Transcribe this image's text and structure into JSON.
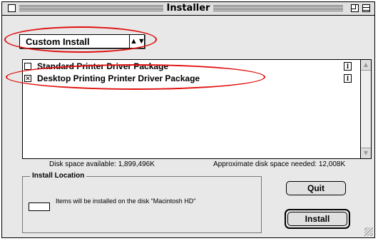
{
  "window": {
    "title": "Installer"
  },
  "install_type": {
    "selected": "Custom Install"
  },
  "packages": [
    {
      "label": "Standard Printer Driver Package",
      "checked": false,
      "check_mark": ""
    },
    {
      "label": "Desktop Printing Printer Driver Package",
      "checked": true,
      "check_mark": "✕"
    }
  ],
  "disk": {
    "available": "Disk space available: 1,899,496K",
    "needed": "Approximate disk space needed: 12,008K"
  },
  "install_location": {
    "legend": "Install Location",
    "text": "Items will be installed on the disk \"Macintosh HD\""
  },
  "buttons": {
    "quit": "Quit",
    "install": "Install"
  },
  "info_label": "I",
  "highlight_color": "#e01010"
}
